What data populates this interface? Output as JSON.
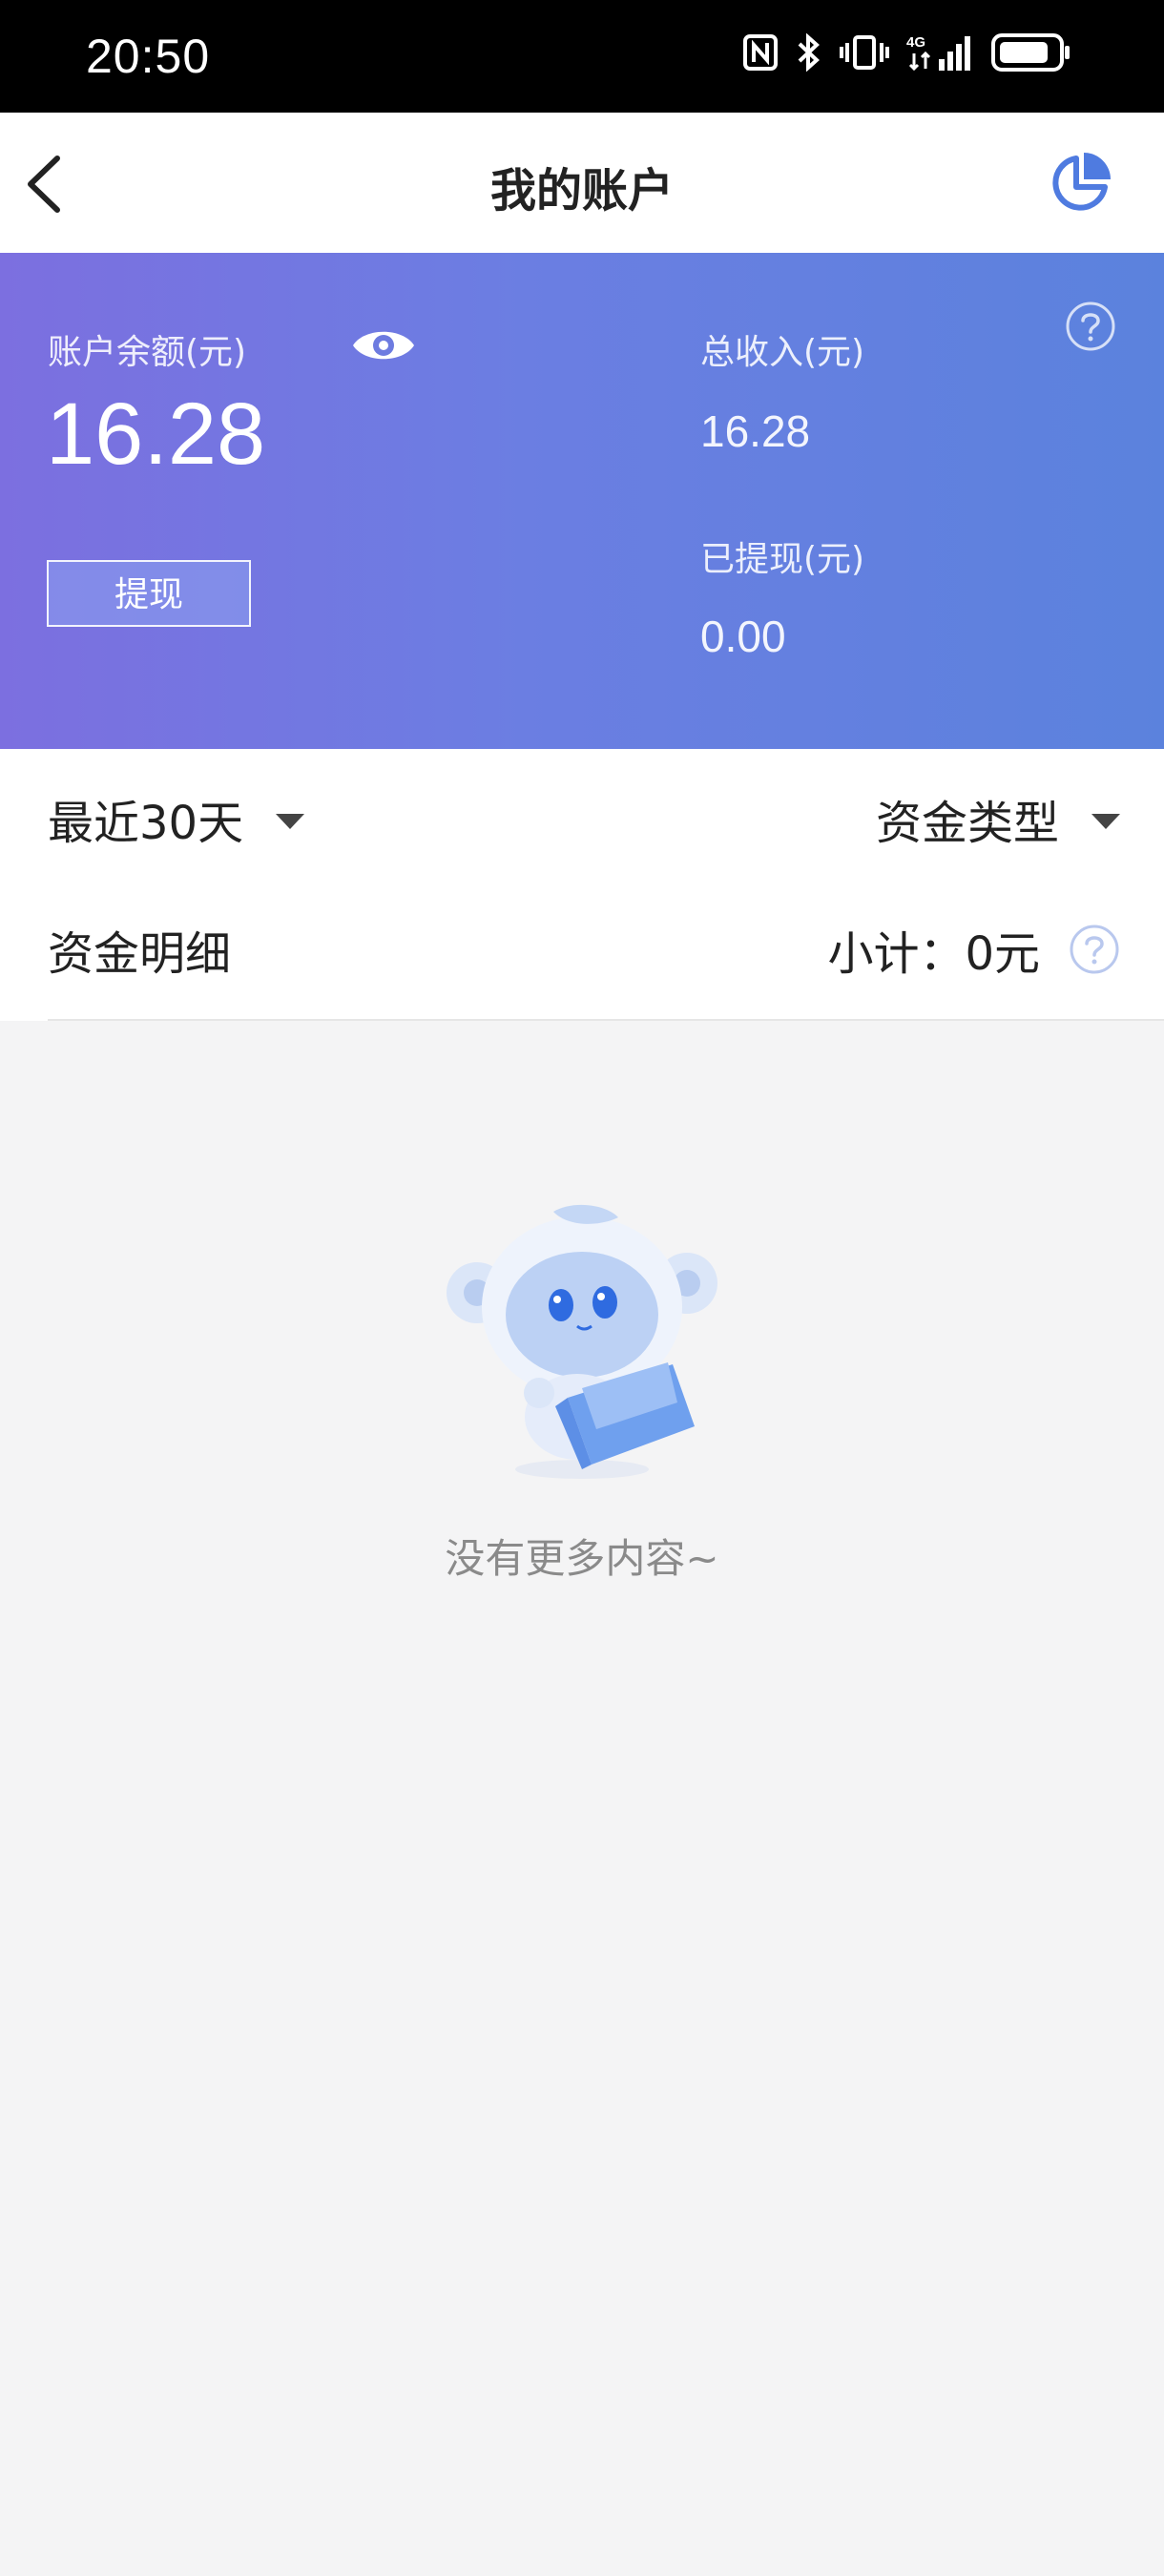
{
  "status_bar": {
    "time": "20:50",
    "icons": [
      "nfc-icon",
      "bluetooth-icon",
      "vibrate-icon",
      "signal-4g-icon",
      "battery-icon"
    ],
    "network_label": "4G"
  },
  "nav": {
    "title": "我的账户",
    "back_icon": "chevron-left-icon",
    "chart_icon": "pie-chart-icon"
  },
  "account": {
    "balance_label": "账户余额(元)",
    "balance_value": "16.28",
    "withdraw_label": "提现",
    "total_income_label": "总收入(元)",
    "total_income_value": "16.28",
    "withdrawn_label": "已提现(元)",
    "withdrawn_value": "0.00"
  },
  "filters": {
    "period": "最近30天",
    "fund_type": "资金类型"
  },
  "detail": {
    "title": "资金明细",
    "subtotal": "小计：0元"
  },
  "empty_state": {
    "message": "没有更多内容~"
  },
  "colors": {
    "card_gradient_start": "#7c6fe0",
    "card_gradient_end": "#5b82dd",
    "accent": "#4f7be0",
    "page_background": "#f4f4f5"
  }
}
